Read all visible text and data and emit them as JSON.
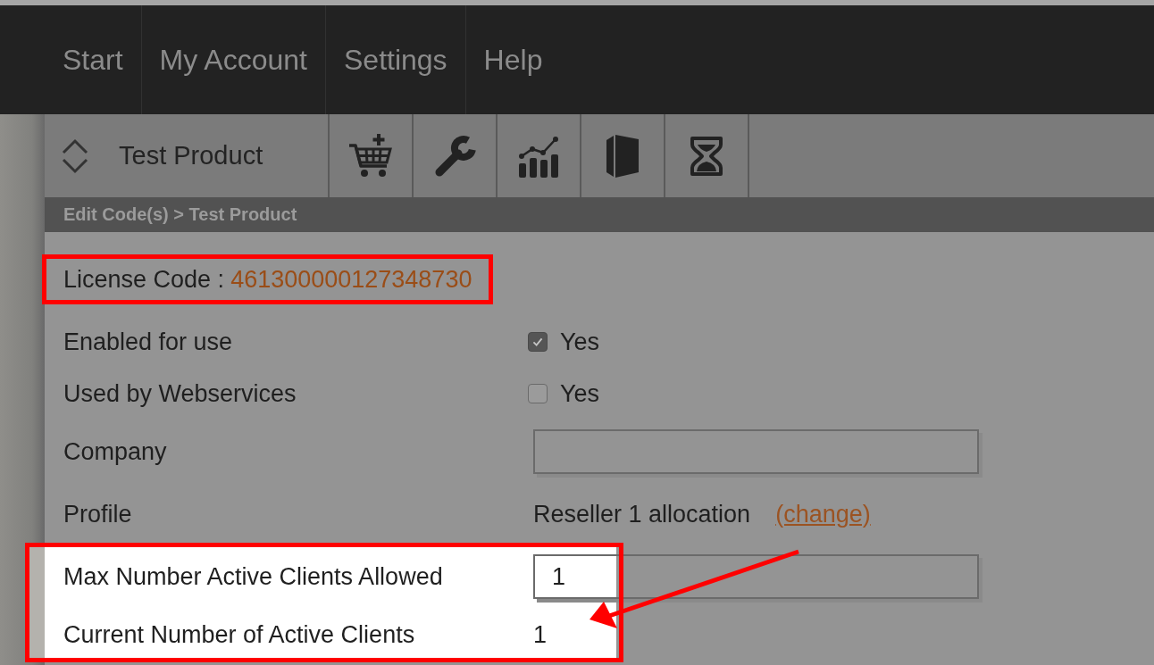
{
  "nav": {
    "items": [
      {
        "label": "Start"
      },
      {
        "label": "My Account"
      },
      {
        "label": "Settings"
      },
      {
        "label": "Help"
      }
    ]
  },
  "product_bar": {
    "product": "Test Product"
  },
  "breadcrumb": "Edit Code(s) > Test Product",
  "license": {
    "label": "License Code :",
    "code": "461300000127348730",
    "framed": true
  },
  "fields": [
    {
      "kind": "checkbox",
      "label": "Enabled for use",
      "checked": true,
      "option": "Yes",
      "highlighted": false
    },
    {
      "kind": "checkbox",
      "label": "Used by Webservices",
      "checked": false,
      "option": "Yes",
      "highlighted": false
    },
    {
      "kind": "text_input",
      "label": "Company",
      "highlighted": false
    },
    {
      "kind": "profile",
      "label": "Profile",
      "value": "Reseller 1 allocation",
      "link": "(change)",
      "highlighted": false
    },
    {
      "kind": "text_input",
      "label": "Max Number Active Clients Allowed",
      "value": "1",
      "highlighted": true
    },
    {
      "kind": "readout",
      "label": "Current Number of Active Clients",
      "value": "1",
      "highlighted": true
    }
  ],
  "annotation_arrow": true
}
